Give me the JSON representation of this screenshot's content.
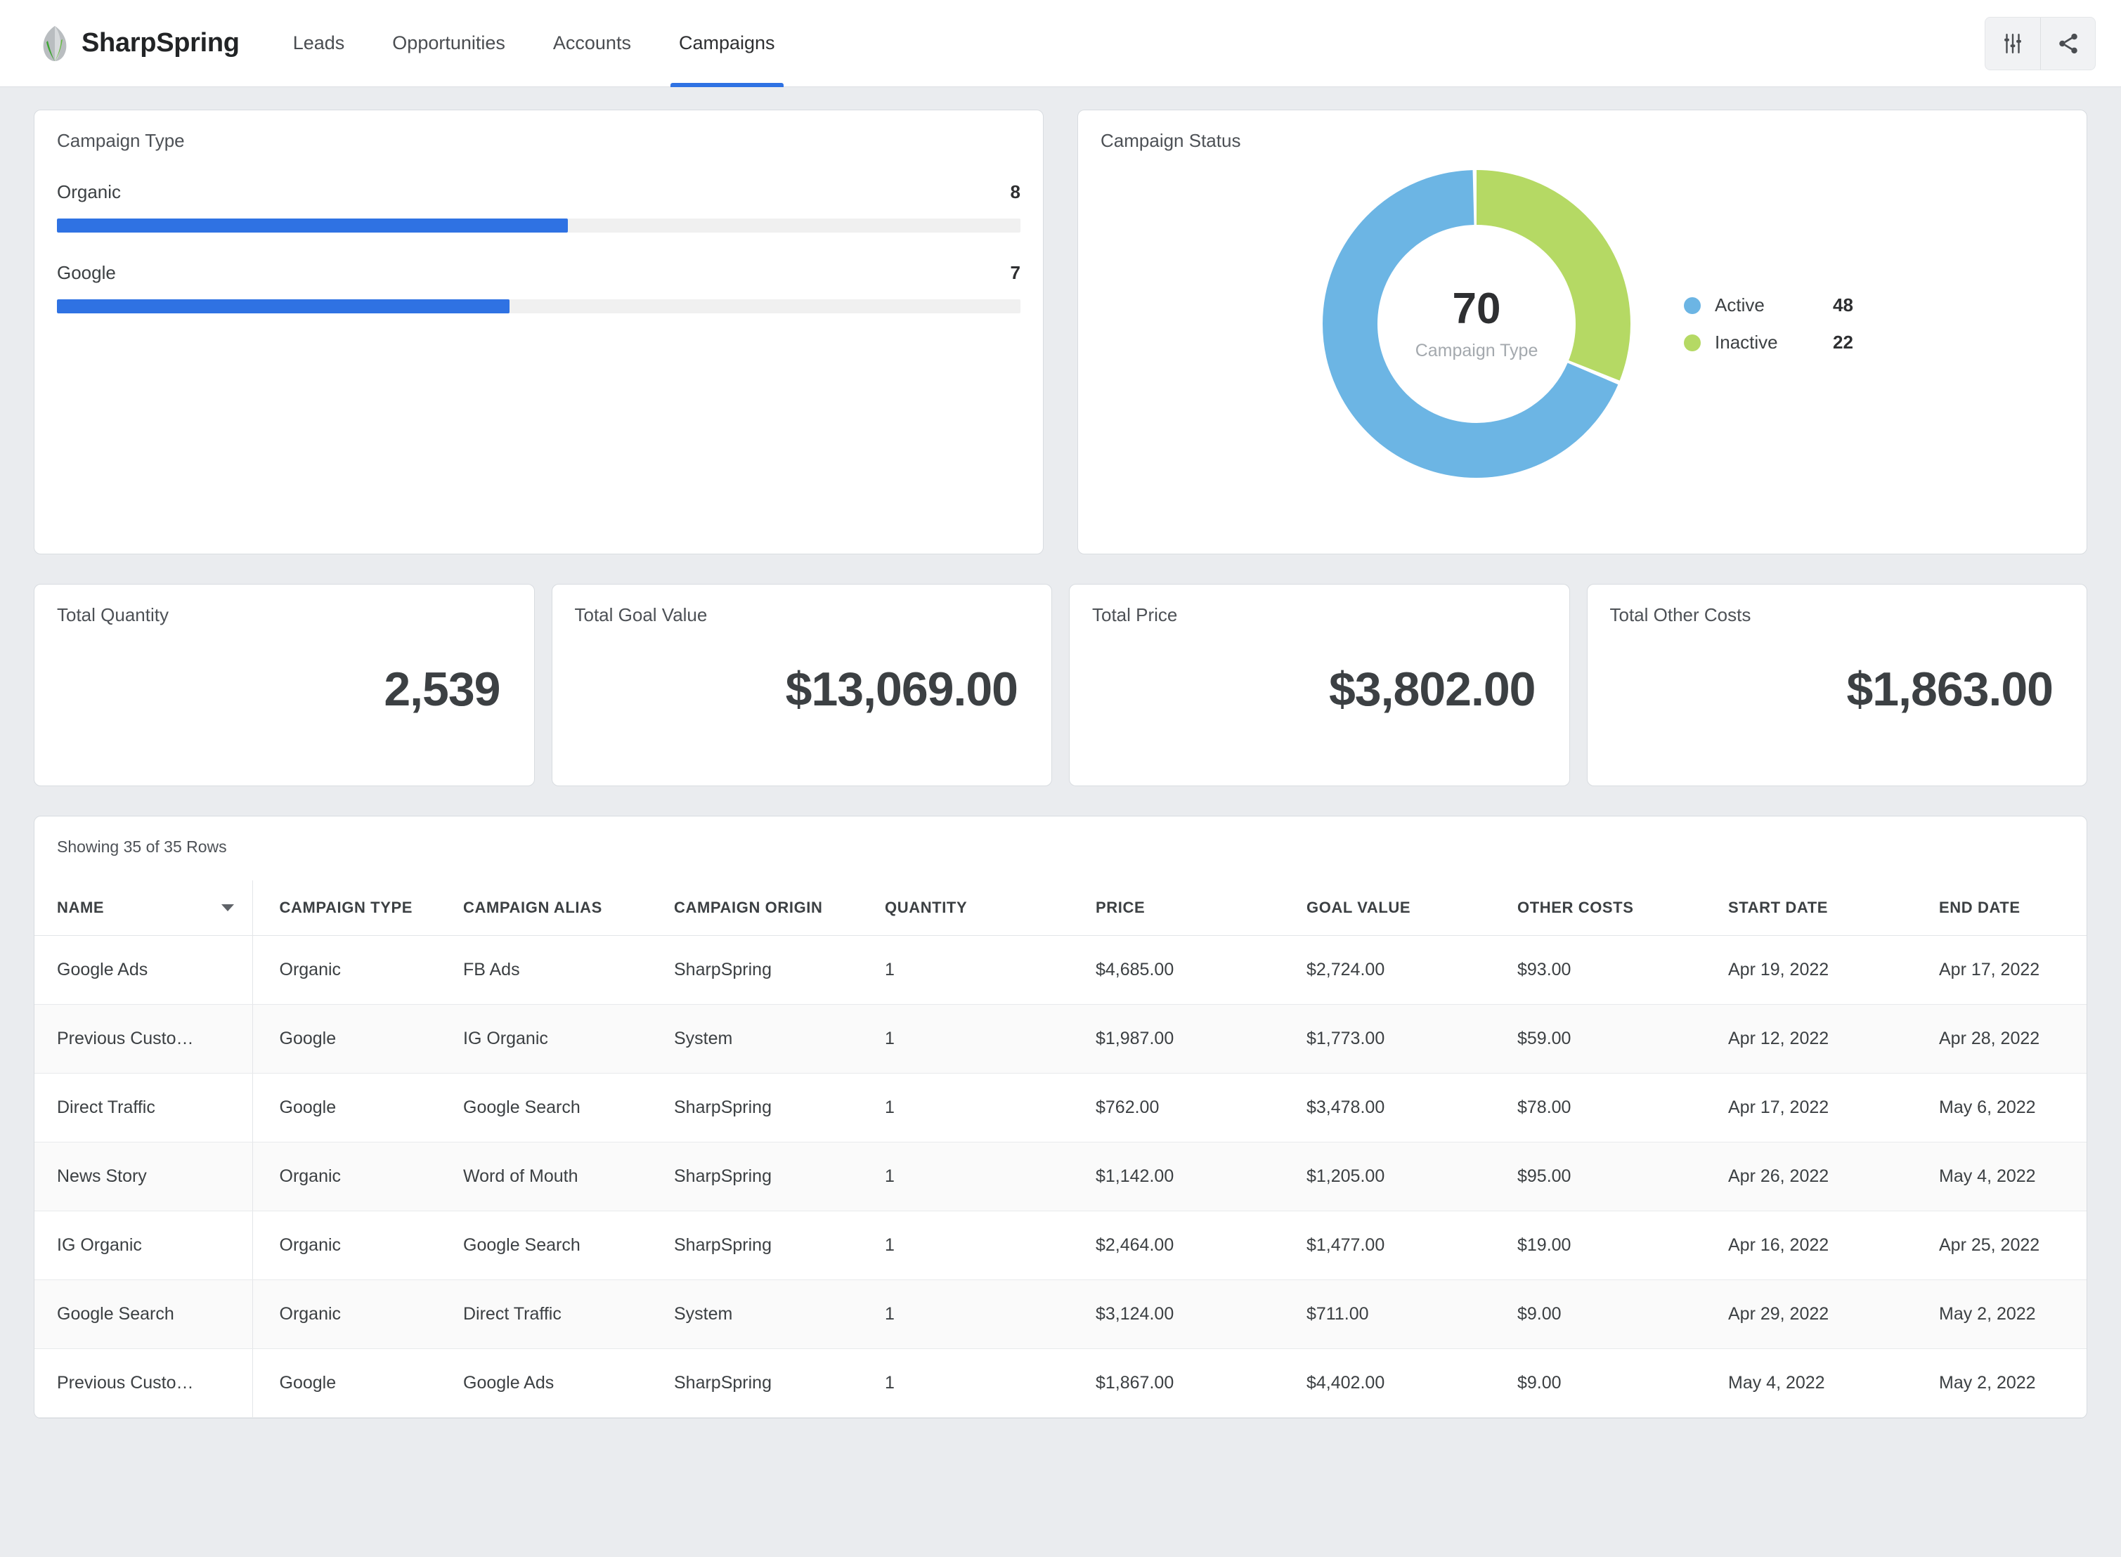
{
  "header": {
    "brand": "SharpSpring",
    "logo_icon": "sharpspring-leaf-logo",
    "tabs": [
      {
        "label": "Leads",
        "active": false
      },
      {
        "label": "Opportunities",
        "active": false
      },
      {
        "label": "Accounts",
        "active": false
      },
      {
        "label": "Campaigns",
        "active": true
      }
    ],
    "actions": [
      {
        "icon": "sliders-filter-icon",
        "label": "Filter settings"
      },
      {
        "icon": "share-icon",
        "label": "Share"
      }
    ]
  },
  "colors": {
    "accent_blue": "#2f72e3",
    "donut_active": "#6cb5e4",
    "donut_inactive": "#b5d964",
    "page_background": "#eaecef",
    "bar_track": "#f0f0f0"
  },
  "campaign_type_card": {
    "title": "Campaign Type",
    "chart_data": {
      "type": "bar",
      "title": "Campaign Type",
      "orientation": "horizontal",
      "categories": [
        "Organic",
        "Google"
      ],
      "values": [
        8,
        7
      ],
      "value_labels": [
        "8",
        "7"
      ],
      "max": 15,
      "xlabel": "",
      "ylabel": "",
      "grid": false,
      "legend": "none",
      "series_color": "#2f72e3",
      "bar_percents": [
        53,
        47
      ]
    }
  },
  "campaign_status_card": {
    "title": "Campaign Status",
    "chart_data": {
      "type": "pie",
      "variant": "donut",
      "title": "Campaign Status",
      "center_value": "70",
      "center_label": "Campaign Type",
      "total": 70,
      "start_angle_deg": 0,
      "direction": "clockwise",
      "legend": "right",
      "slices": [
        {
          "name": "Inactive",
          "value": 22,
          "color": "#b5d964",
          "percent": 31.4
        },
        {
          "name": "Active",
          "value": 48,
          "color": "#6cb5e4",
          "percent": 68.6
        }
      ],
      "legend_entries": [
        {
          "name": "Active",
          "value": "48",
          "color": "#6cb5e4"
        },
        {
          "name": "Inactive",
          "value": "22",
          "color": "#b5d964"
        }
      ]
    }
  },
  "kpis": [
    {
      "title": "Total Quantity",
      "value": "2,539"
    },
    {
      "title": "Total Goal Value",
      "value": "$13,069.00"
    },
    {
      "title": "Total Price",
      "value": "$3,802.00"
    },
    {
      "title": "Total Other Costs",
      "value": "$1,863.00"
    }
  ],
  "table": {
    "meta": "Showing 35 of 35 Rows",
    "sorted_column": "NAME",
    "sort_direction": "descending",
    "columns": [
      "NAME",
      "CAMPAIGN TYPE",
      "CAMPAIGN ALIAS",
      "CAMPAIGN ORIGIN",
      "QUANTITY",
      "PRICE",
      "GOAL VALUE",
      "OTHER COSTS",
      "START DATE",
      "END DATE"
    ],
    "rows": [
      {
        "name": "Google Ads",
        "campaign_type": "Organic",
        "campaign_alias": "FB Ads",
        "campaign_origin": "SharpSpring",
        "quantity": "1",
        "price": "$4,685.00",
        "goal_value": "$2,724.00",
        "other_costs": "$93.00",
        "start_date": "Apr 19, 2022",
        "end_date": "Apr 17, 2022"
      },
      {
        "name": "Previous Custo…",
        "campaign_type": "Google",
        "campaign_alias": "IG Organic",
        "campaign_origin": "System",
        "quantity": "1",
        "price": "$1,987.00",
        "goal_value": "$1,773.00",
        "other_costs": "$59.00",
        "start_date": "Apr 12, 2022",
        "end_date": "Apr 28, 2022"
      },
      {
        "name": "Direct Traffic",
        "campaign_type": "Google",
        "campaign_alias": "Google Search",
        "campaign_origin": "SharpSpring",
        "quantity": "1",
        "price": "$762.00",
        "goal_value": "$3,478.00",
        "other_costs": "$78.00",
        "start_date": "Apr 17, 2022",
        "end_date": "May 6, 2022"
      },
      {
        "name": "News Story",
        "campaign_type": "Organic",
        "campaign_alias": "Word of Mouth",
        "campaign_origin": "SharpSpring",
        "quantity": "1",
        "price": "$1,142.00",
        "goal_value": "$1,205.00",
        "other_costs": "$95.00",
        "start_date": "Apr 26, 2022",
        "end_date": "May 4, 2022"
      },
      {
        "name": "IG Organic",
        "campaign_type": "Organic",
        "campaign_alias": "Google Search",
        "campaign_origin": "SharpSpring",
        "quantity": "1",
        "price": "$2,464.00",
        "goal_value": "$1,477.00",
        "other_costs": "$19.00",
        "start_date": "Apr 16, 2022",
        "end_date": "Apr 25, 2022"
      },
      {
        "name": "Google Search",
        "campaign_type": "Organic",
        "campaign_alias": "Direct Traffic",
        "campaign_origin": "System",
        "quantity": "1",
        "price": "$3,124.00",
        "goal_value": "$711.00",
        "other_costs": "$9.00",
        "start_date": "Apr 29, 2022",
        "end_date": "May 2, 2022"
      },
      {
        "name": "Previous Custo…",
        "campaign_type": "Google",
        "campaign_alias": "Google Ads",
        "campaign_origin": "SharpSpring",
        "quantity": "1",
        "price": "$1,867.00",
        "goal_value": "$4,402.00",
        "other_costs": "$9.00",
        "start_date": "May 4, 2022",
        "end_date": "May 2, 2022"
      }
    ]
  }
}
